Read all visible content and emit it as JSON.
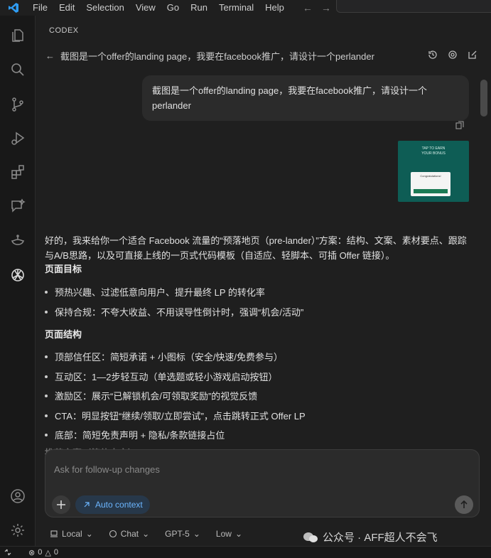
{
  "menu": [
    "File",
    "Edit",
    "Selection",
    "View",
    "Go",
    "Run",
    "Terminal",
    "Help"
  ],
  "activity_icons": [
    "explorer-icon",
    "search-icon",
    "source-control-icon",
    "run-debug-icon",
    "extensions-icon",
    "chat-icon",
    "lamp-icon",
    "openai-icon"
  ],
  "activity_bottom": [
    "account-icon",
    "settings-gear-icon"
  ],
  "panel": {
    "label": "CODEX",
    "thread_title": "截图是一个offer的landing page，我要在facebook推广，请设计一个perlander"
  },
  "chat": {
    "user_message": "截图是一个offer的landing page，我要在facebook推广，请设计一个perlander",
    "thumb_text": [
      "TAP TO EARN",
      "YOUR BONUS",
      "Congratulations!",
      "START"
    ],
    "ai_intro": "好的，我来给你一个适合 Facebook 流量的“预落地页（pre-lander）”方案：结构、文案、素材要点、跟踪与A/B思路，以及可直接上线的一页式代码模板（自适应、轻脚本、可插 Offer 链接）。",
    "goal_heading": "页面目标",
    "goal_items": [
      "预热兴趣、过滤低意向用户、提升最终 LP 的转化率",
      "保持合规：不夸大收益、不用误导性倒计时，强调“机会/活动”"
    ],
    "structure_heading": "页面结构",
    "structure_items": [
      "顶部信任区：简短承诺 + 小图标（安全/快速/免费参与）",
      "互动区：1—2步轻互动（单选题或轻小游戏启动按钮）",
      "激励区：展示“已解锁机会/可领取奖励”的视觉反馈",
      "CTA：明显按钮“继续/领取/立即尝试”，点击跳转正式 Offer LP",
      "底部：简短免责声明 + 隐私/条款链接占位"
    ],
    "next_heading": "推荐文案（简体中文）"
  },
  "composer": {
    "placeholder": "Ask for follow-up changes",
    "context_label": "Auto context"
  },
  "options": {
    "env": "Local",
    "mode": "Chat",
    "model": "GPT-5",
    "effort": "Low"
  },
  "watermark": "公众号 · AFF超人不会飞",
  "status": {
    "errors": "0",
    "warnings": "0"
  }
}
